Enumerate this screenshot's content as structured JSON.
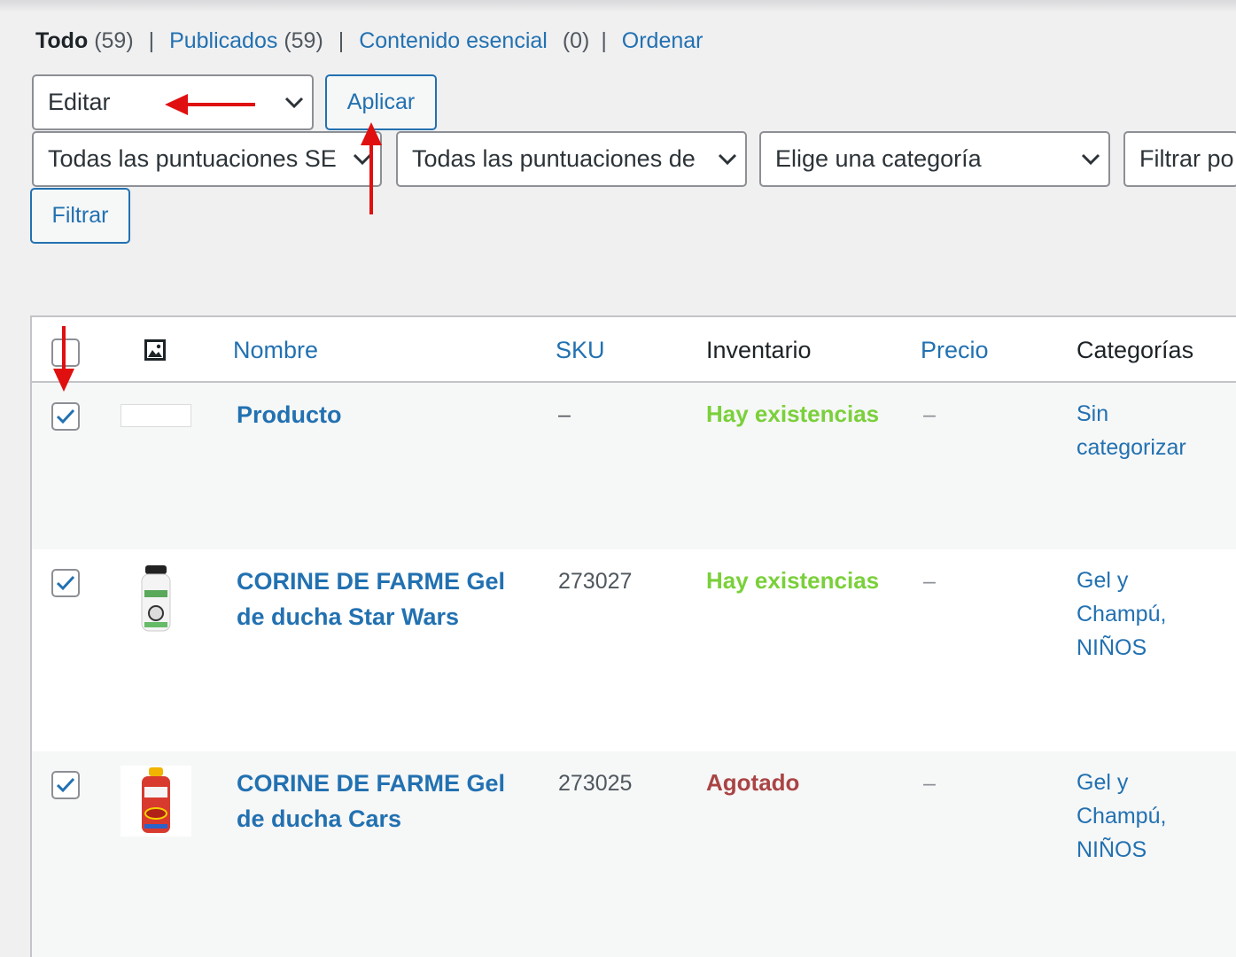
{
  "filters_nav": {
    "all_label": "Todo",
    "all_count": "(59)",
    "published_label": "Publicados",
    "published_count": "(59)",
    "essential_label": "Contenido esencial",
    "essential_count": "(0)",
    "sort_label": "Ordenar",
    "separator": "|"
  },
  "bulk_actions": {
    "selected": "Editar",
    "apply_label": "Aplicar"
  },
  "filter_bar": {
    "rating_select_1": "Todas las puntuaciones SE",
    "rating_select_2": "Todas las puntuaciones de",
    "category_select": "Elige una categoría",
    "type_select": "Filtrar po",
    "filter_button": "Filtrar"
  },
  "table": {
    "headers": {
      "name": "Nombre",
      "sku": "SKU",
      "stock": "Inventario",
      "price": "Precio",
      "categories": "Categorías"
    },
    "rows": [
      {
        "name": "Producto",
        "sku": "–",
        "stock": "Hay existencias",
        "stock_status": "in",
        "price": "–",
        "cat_line1": "Sin",
        "cat_line2": "categorizar",
        "cat_line3": ""
      },
      {
        "name_line1": "CORINE DE FARME Gel",
        "name_line2": "de ducha Star Wars",
        "sku": "273027",
        "stock": "Hay existencias",
        "stock_status": "in",
        "price": "–",
        "cat_line1": "Gel y",
        "cat_line2": "Champú,",
        "cat_line3": "NIÑOS"
      },
      {
        "name_line1": "CORINE DE FARME Gel",
        "name_line2": "de ducha Cars",
        "sku": "273025",
        "stock": "Agotado",
        "stock_status": "out",
        "price": "–",
        "cat_line1": "Gel y",
        "cat_line2": "Champú,",
        "cat_line3": "NIÑOS"
      }
    ]
  },
  "colors": {
    "link": "#2271b1",
    "in_stock": "#7ad03a",
    "out_of_stock": "#aa4444",
    "annotation_arrow": "#e01010"
  },
  "icons": [
    "chevron-down-icon",
    "image-icon",
    "checkmark-icon",
    "red-arrow-annotation"
  ]
}
